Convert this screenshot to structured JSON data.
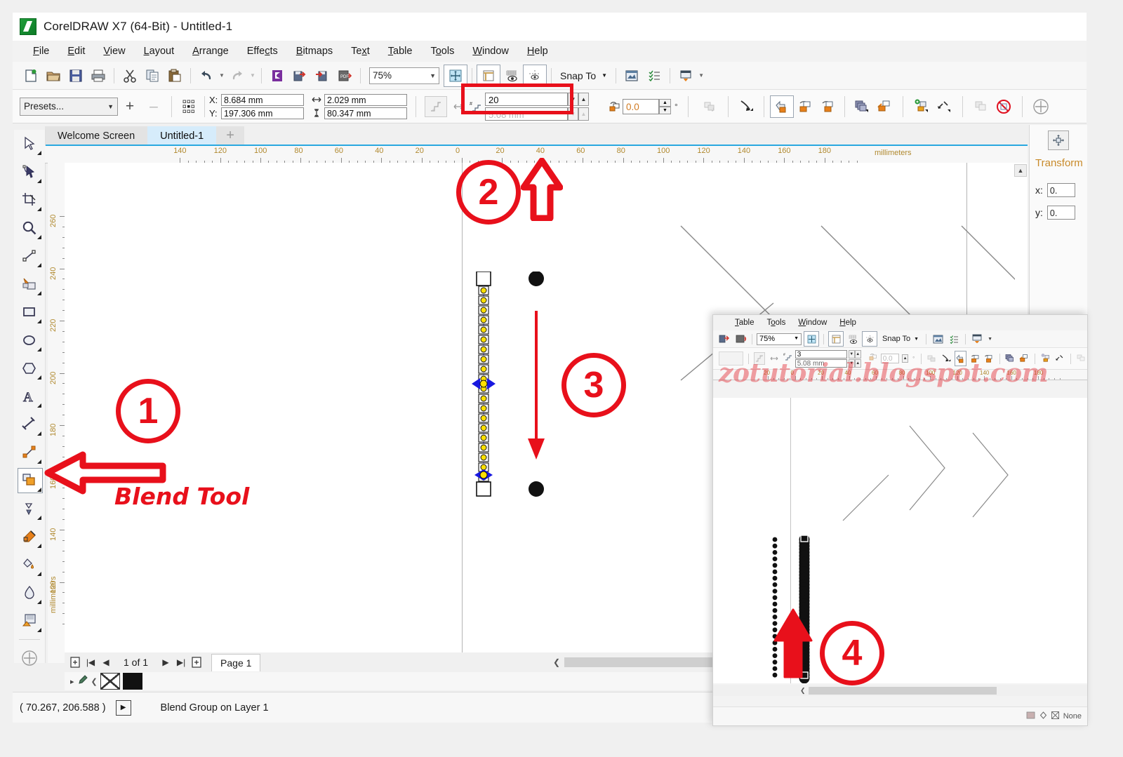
{
  "window": {
    "title": "CorelDRAW X7 (64-Bit) - Untitled-1",
    "logo_icon": "coreldraw-logo"
  },
  "menubar": {
    "items": [
      {
        "label": "File",
        "accel": "F"
      },
      {
        "label": "Edit",
        "accel": "E"
      },
      {
        "label": "View",
        "accel": "V"
      },
      {
        "label": "Layout",
        "accel": "L"
      },
      {
        "label": "Arrange",
        "accel": "A"
      },
      {
        "label": "Effects",
        "accel": "c"
      },
      {
        "label": "Bitmaps",
        "accel": "B"
      },
      {
        "label": "Text",
        "accel": "x"
      },
      {
        "label": "Table",
        "accel": "T"
      },
      {
        "label": "Tools",
        "accel": "o"
      },
      {
        "label": "Window",
        "accel": "W"
      },
      {
        "label": "Help",
        "accel": "H"
      }
    ]
  },
  "toolbar": {
    "buttons": [
      "new-document-icon",
      "open-document-icon",
      "save-icon",
      "print-icon",
      "cut-icon",
      "copy-icon",
      "paste-icon",
      "undo-icon",
      "redo-icon",
      "corel-connect-icon",
      "import-icon",
      "export-icon",
      "publish-pdf-icon"
    ],
    "zoom_level": "75%",
    "zoom_caret": "chevron-down-icon",
    "fullscreen_icon": "zoom-levels-icon",
    "options_icons": [
      "page-border-icon",
      "view-icon",
      "snap-guides-icon"
    ],
    "snap_to_label": "Snap To",
    "snap_to_caret": "chevron-down-icon",
    "right_icons": [
      "options-icon",
      "object-manager-icon",
      "launch-icon"
    ]
  },
  "propertybar": {
    "presets_label": "Presets...",
    "presets_caret": "chevron-down-icon",
    "add_preset": "+",
    "remove_preset": "–",
    "anchor_icon": "object-origin-icon",
    "x_label": "X:",
    "x_value": "8.684 mm",
    "y_label": "Y:",
    "y_value": "197.306 mm",
    "width_icon": "width-icon",
    "width_value": "2.029 mm",
    "height_icon": "height-icon",
    "height_value": "80.347 mm",
    "acceleration_icon": "blend-acceleration-icon",
    "spacing_icon": "blend-spacing-icon",
    "steps_icon": "blend-steps-icon",
    "steps_value": "20",
    "spacing_value": "5.08 mm",
    "rotation_icon": "blend-rotation-icon",
    "rotation_value": "0.0",
    "degree_symbol": "°",
    "tool_icons": [
      "loop-blend-icon",
      "blend-direction-icon",
      "path-properties-icon",
      "start-object-icon",
      "end-object-icon",
      "more-blend-options-icon",
      "object-acceleration-icon",
      "copy-blend-icon",
      "clear-blend-icon",
      "new-blend-icon",
      "fuse-blend-icon",
      "split-blend-icon"
    ],
    "highlight_color": "#e8101b"
  },
  "tabs": {
    "items": [
      {
        "label": "Welcome Screen",
        "active": false
      },
      {
        "label": "Untitled-1",
        "active": true
      }
    ],
    "add_label": "+"
  },
  "toolbox": {
    "tools": [
      {
        "name": "pick-tool",
        "selected": false
      },
      {
        "name": "shape-tool",
        "selected": false
      },
      {
        "name": "crop-tool",
        "selected": false
      },
      {
        "name": "zoom-tool",
        "selected": false
      },
      {
        "name": "freehand-tool",
        "selected": false
      },
      {
        "name": "smart-fill-tool",
        "selected": false
      },
      {
        "name": "rectangle-tool",
        "selected": false
      },
      {
        "name": "ellipse-tool",
        "selected": false
      },
      {
        "name": "polygon-tool",
        "selected": false
      },
      {
        "name": "text-tool",
        "selected": false
      },
      {
        "name": "dimension-tool",
        "selected": false
      },
      {
        "name": "connector-tool",
        "selected": false
      },
      {
        "name": "blend-tool",
        "selected": true
      },
      {
        "name": "color-eyedropper-tool",
        "selected": false
      },
      {
        "name": "outline-tool",
        "selected": false
      },
      {
        "name": "fill-tool",
        "selected": false
      },
      {
        "name": "interactive-fill-tool",
        "selected": false
      },
      {
        "name": "transparency-tool",
        "selected": false
      },
      {
        "name": "quick-customize-tool",
        "selected": false
      }
    ]
  },
  "rulers": {
    "horizontal_labels": [
      "140",
      "120",
      "100",
      "80",
      "60",
      "40",
      "20",
      "0",
      "20",
      "40",
      "60",
      "80",
      "100",
      "120",
      "140",
      "160",
      "180"
    ],
    "unit_label": "millimeters",
    "vertical_labels": [
      "260",
      "240",
      "220",
      "200",
      "180",
      "160",
      "140",
      "120"
    ],
    "vertical_unit_label": "millimeters"
  },
  "canvas": {
    "blend_steps_shown": 20,
    "source_shape": "square-control-node",
    "target_shape": "square-control-node",
    "circles": [
      "black-circle-top",
      "black-circle-bottom"
    ]
  },
  "docnav": {
    "add_page_before_icon": "add-page-icon",
    "first_icon": "first-page-icon",
    "prev_icon": "previous-page-icon",
    "page_counter": "1 of 1",
    "next_icon": "next-page-icon",
    "last_icon": "last-page-icon",
    "add_page_after_icon": "add-page-icon",
    "page_tab": "Page 1"
  },
  "colorstrip": {
    "expand_icon": "expand-icon",
    "eyedropper_icon": "eyedropper-icon",
    "prev_icon": "scroll-left-icon",
    "none_swatch": "no-color-swatch",
    "black_swatch": "#111111"
  },
  "statusbar": {
    "coordinates": "( 70.267, 206.588 )",
    "expand_icon": "expand-status-icon",
    "object_info": "Blend Group on Layer 1"
  },
  "docker": {
    "title": "Transform",
    "x_label": "x:",
    "x_value": "0.",
    "y_label": "y:",
    "y_value": "0.",
    "position_icon": "transform-position-icon"
  },
  "annotations": [
    {
      "id": "1",
      "label": "Blend Tool",
      "target": "blend-tool-in-toolbox",
      "color": "#e8101b"
    },
    {
      "id": "2",
      "label": "",
      "target": "blend-steps-field",
      "color": "#e8101b"
    },
    {
      "id": "3",
      "label": "",
      "target": "blend-direction-on-canvas",
      "color": "#e8101b"
    },
    {
      "id": "4",
      "label": "",
      "target": "blend-result-in-inset",
      "color": "#e8101b"
    }
  ],
  "inset": {
    "menubar": [
      {
        "label": "Table",
        "accel": "T"
      },
      {
        "label": "Tools",
        "accel": "o"
      },
      {
        "label": "Window",
        "accel": "W"
      },
      {
        "label": "Help",
        "accel": "H"
      }
    ],
    "toolbar": {
      "import_icon": "import-icon",
      "export_icon": "export-icon",
      "zoom_level": "75%",
      "zoom_caret": "chevron-down-icon",
      "fullscreen_icon": "zoom-levels-icon",
      "options_icons": [
        "page-border-icon",
        "view-icon",
        "snap-guides-icon"
      ],
      "snap_to_label": "Snap To",
      "snap_to_caret": "chevron-down-icon",
      "right_icons": [
        "options-icon",
        "object-manager-icon",
        "launch-icon"
      ]
    },
    "propertybar": {
      "acceleration_icon": "blend-acceleration-icon",
      "spacing_icon": "blend-spacing-icon",
      "steps_icon": "blend-steps-icon",
      "steps_value": "3",
      "spacing_value": "5.08 mm",
      "rotation_value": "0.0",
      "degree_symbol": "°",
      "tool_icons": [
        "loop-blend-icon",
        "blend-direction-icon",
        "path-properties-icon",
        "start-object-icon",
        "end-object-icon",
        "more-blend-options-icon",
        "object-acceleration-icon",
        "copy-blend-icon",
        "split-blend-icon"
      ]
    },
    "ruler_labels": [
      "20",
      "0",
      "20",
      "40",
      "60",
      "80",
      "100",
      "120",
      "140",
      "160",
      "180"
    ],
    "watermark": "zotutorial.blogspot.com",
    "watermark_color": "rgba(226,30,40,.42)",
    "status_right": "None",
    "status_icons": [
      "fill-status-icon",
      "outline-status-icon",
      "no-color-icon"
    ]
  }
}
